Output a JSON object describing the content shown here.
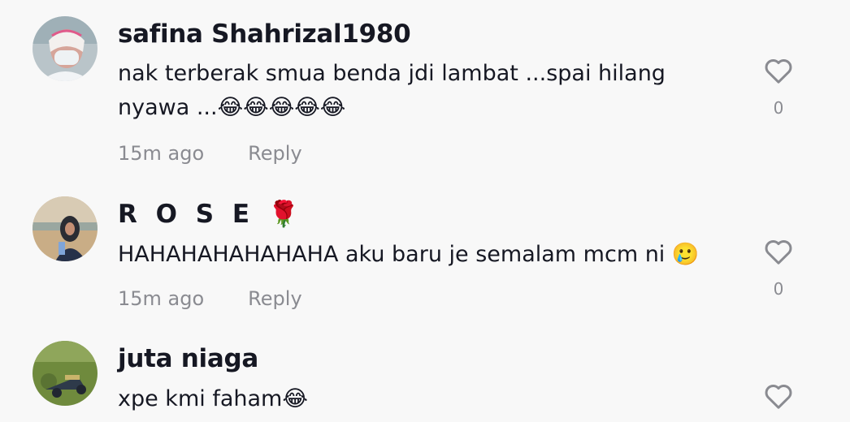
{
  "comments": [
    {
      "username": "safina Shahrizal1980",
      "text": "nak terberak smua benda jdi lambat ...spai hilang\nnyawa ...😂😂😂😂😂",
      "time": "15m ago",
      "reply_label": "Reply",
      "likes": "0"
    },
    {
      "username": "R O S E 🌹",
      "text": "HAHAHAHAHAHAHA aku baru je semalam mcm ni 🥲",
      "time": "15m ago",
      "reply_label": "Reply",
      "likes": "0"
    },
    {
      "username": "juta niaga",
      "text": "xpe kmi faham😂",
      "time": "",
      "reply_label": "",
      "likes": ""
    }
  ],
  "colors": {
    "text": "#161823",
    "muted": "#8a8b91",
    "background": "#f8f8f8"
  },
  "icons": {
    "like": "heart-outline-icon"
  }
}
